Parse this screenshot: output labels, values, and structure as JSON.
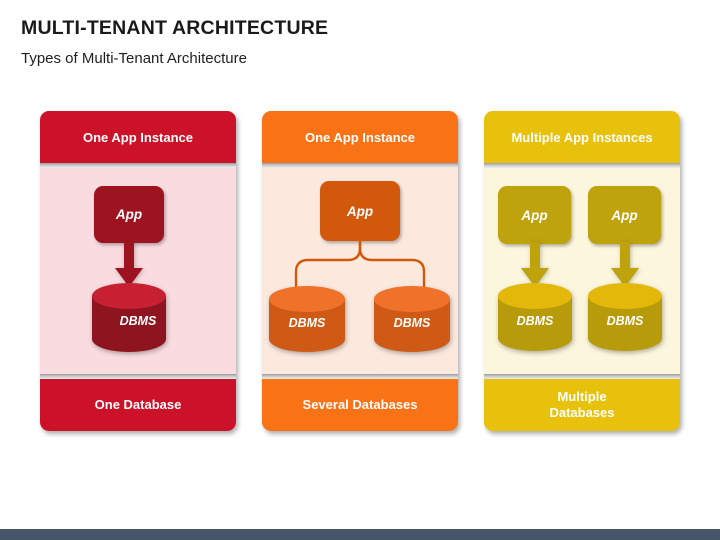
{
  "slide": {
    "title": "MULTI-TENANT ARCHITECTURE",
    "subtitle": "Types of Multi-Tenant Architecture"
  },
  "theme": {
    "bottom_bar_color": "#475569",
    "page_background": "#FFFFFF"
  },
  "panels": [
    {
      "id": "single-tenant",
      "header": "One App Instance",
      "footer": "One Database",
      "colors": {
        "header_bg": "#CC1228",
        "body_bg": "#FADCE0",
        "footer_bg": "#CC1228",
        "app_fill": "#9E1320",
        "cylinder_top": "#C62032",
        "cylinder_body": "#8E1520",
        "connector": "#9E1320"
      },
      "apps": [
        {
          "label": "App"
        }
      ],
      "databases": [
        {
          "label": "DBMS"
        }
      ],
      "connector_type": "arrow"
    },
    {
      "id": "one-app-several-db",
      "header": "One App Instance",
      "footer": "Several Databases",
      "colors": {
        "header_bg": "#F97316",
        "body_bg": "#FCE9DE",
        "footer_bg": "#F97316",
        "app_fill": "#D2590C",
        "cylinder_top": "#F0712A",
        "cylinder_body": "#CE5A16",
        "connector": "#D2590C"
      },
      "apps": [
        {
          "label": "App"
        }
      ],
      "databases": [
        {
          "label": "DBMS"
        },
        {
          "label": "DBMS"
        }
      ],
      "connector_type": "fork"
    },
    {
      "id": "multiple-app-multiple-db",
      "header": "Multiple App Instances",
      "footer": "Multiple\nDatabases",
      "colors": {
        "header_bg": "#E8C10C",
        "body_bg": "#FCF6DC",
        "footer_bg": "#E8C10C",
        "app_fill": "#BFA30C",
        "cylinder_top": "#E3B80A",
        "cylinder_body": "#B79B0B",
        "connector": "#A8890A"
      },
      "apps": [
        {
          "label": "App"
        },
        {
          "label": "App"
        }
      ],
      "databases": [
        {
          "label": "DBMS"
        },
        {
          "label": "DBMS"
        }
      ],
      "connector_type": "arrow-pair"
    }
  ]
}
